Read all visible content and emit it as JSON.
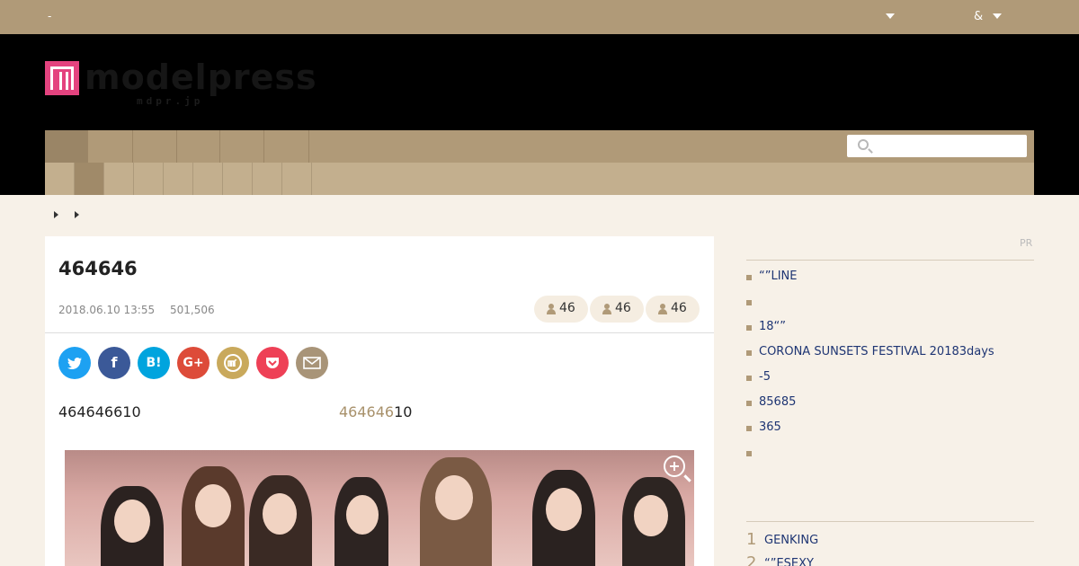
{
  "topbar": {
    "left_text": "-",
    "menu_amp": "&"
  },
  "header": {
    "logo_word": "modelpress",
    "logo_sub": "mdpr.jp",
    "search_placeholder": ""
  },
  "article": {
    "title": "464646",
    "date": "2018.06.10 13:55",
    "views": "501,506",
    "tags": [
      "46",
      "46",
      "46"
    ],
    "share": {
      "twitter": "",
      "facebook": "f",
      "hatena": "B!",
      "googleplus": "G+",
      "mdpr": "m",
      "pocket": "",
      "mail": ""
    },
    "lead_text": "464646610",
    "lead_link": "464646",
    "lead_suffix": "10"
  },
  "sidebar": {
    "pr_label": "PR",
    "pr_items": [
      "“”LINE",
      "",
      "18“”",
      "CORONA SUNSETS FESTIVAL 20183days",
      "-5",
      "85685",
      "365",
      ""
    ],
    "ranking": [
      {
        "rank": "1",
        "label": "GENKING"
      },
      {
        "rank": "2",
        "label": "“”ESEXY"
      }
    ]
  },
  "colors": {
    "accent": "#b09a78",
    "logo_pink": "#e4437f",
    "link": "#1e3573"
  }
}
